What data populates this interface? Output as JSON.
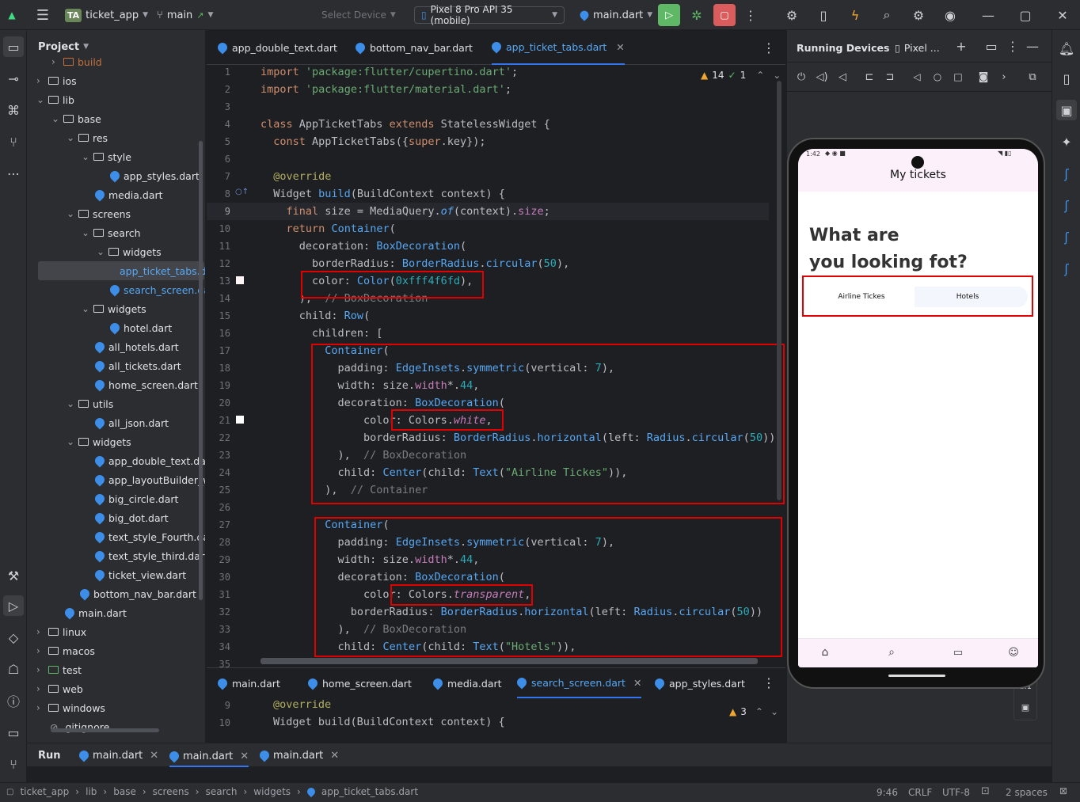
{
  "titlebar": {
    "project_badge": "TA",
    "project_name": "ticket_app",
    "branch": "main",
    "select_device": "Select Device",
    "device": "Pixel 8 Pro API 35 (mobile)",
    "run_config": "main.dart"
  },
  "project_panel": {
    "title": "Project",
    "rows": [
      {
        "label": "build",
        "kind": "folder"
      },
      {
        "label": "ios",
        "kind": "folder"
      },
      {
        "label": "lib",
        "kind": "folder"
      },
      {
        "label": "base",
        "kind": "folder"
      },
      {
        "label": "res",
        "kind": "folder"
      },
      {
        "label": "style",
        "kind": "folder"
      },
      {
        "label": "app_styles.dart",
        "kind": "dart"
      },
      {
        "label": "media.dart",
        "kind": "dart"
      },
      {
        "label": "screens",
        "kind": "folder"
      },
      {
        "label": "search",
        "kind": "folder"
      },
      {
        "label": "widgets",
        "kind": "folder"
      },
      {
        "label": "app_ticket_tabs.dart",
        "kind": "dart"
      },
      {
        "label": "search_screen.dart",
        "kind": "dart"
      },
      {
        "label": "widgets",
        "kind": "folder"
      },
      {
        "label": "hotel.dart",
        "kind": "dart"
      },
      {
        "label": "all_hotels.dart",
        "kind": "dart"
      },
      {
        "label": "all_tickets.dart",
        "kind": "dart"
      },
      {
        "label": "home_screen.dart",
        "kind": "dart"
      },
      {
        "label": "utils",
        "kind": "folder"
      },
      {
        "label": "all_json.dart",
        "kind": "dart"
      },
      {
        "label": "widgets",
        "kind": "folder"
      },
      {
        "label": "app_double_text.dart",
        "kind": "dart"
      },
      {
        "label": "app_layoutBuilder_widget.dart",
        "kind": "dart"
      },
      {
        "label": "big_circle.dart",
        "kind": "dart"
      },
      {
        "label": "big_dot.dart",
        "kind": "dart"
      },
      {
        "label": "text_style_Fourth.dart",
        "kind": "dart"
      },
      {
        "label": "text_style_third.dart",
        "kind": "dart"
      },
      {
        "label": "ticket_view.dart",
        "kind": "dart"
      },
      {
        "label": "bottom_nav_bar.dart",
        "kind": "dart"
      },
      {
        "label": "main.dart",
        "kind": "dart"
      },
      {
        "label": "linux",
        "kind": "folder"
      },
      {
        "label": "macos",
        "kind": "folder"
      },
      {
        "label": "test",
        "kind": "folder"
      },
      {
        "label": "web",
        "kind": "folder"
      },
      {
        "label": "windows",
        "kind": "folder"
      },
      {
        "label": ".gitignore",
        "kind": "file"
      }
    ]
  },
  "editor": {
    "tabs": [
      "app_double_text.dart",
      "bottom_nav_bar.dart",
      "app_ticket_tabs.dart"
    ],
    "warnings": "14",
    "checks": "1",
    "line_numbers": [
      "1",
      "2",
      "3",
      "4",
      "5",
      "6",
      "7",
      "8",
      "9",
      "10",
      "11",
      "12",
      "13",
      "14",
      "15",
      "16",
      "17",
      "18",
      "19",
      "20",
      "21",
      "22",
      "23",
      "24",
      "25",
      "26",
      "27",
      "28",
      "29",
      "30",
      "31",
      "32",
      "33",
      "34",
      "35"
    ]
  },
  "lower_editor": {
    "tabs": [
      "main.dart",
      "home_screen.dart",
      "media.dart",
      "search_screen.dart",
      "app_styles.dart"
    ],
    "line9": "9",
    "line10": "10",
    "code9": "@override",
    "code10": "Widget build(BuildContext context) {",
    "warnings": "3"
  },
  "running": {
    "title": "Running Devices",
    "device_tab": "Pixel ..."
  },
  "phone": {
    "status_time": "1:42",
    "appbar_title": "My tickets",
    "heading_line1": "What are",
    "heading_line2": "you looking fot?",
    "tab_airline": "Airline Tickes",
    "tab_hotels": "Hotels",
    "zoom": "1:1"
  },
  "runbar": {
    "label": "Run",
    "tabs": [
      "main.dart",
      "main.dart",
      "main.dart"
    ]
  },
  "statusbar": {
    "crumbs": [
      "ticket_app",
      "lib",
      "base",
      "screens",
      "search",
      "widgets",
      "app_ticket_tabs.dart"
    ],
    "position": "9:46",
    "line_sep": "CRLF",
    "encoding": "UTF-8",
    "indent": "2 spaces"
  }
}
